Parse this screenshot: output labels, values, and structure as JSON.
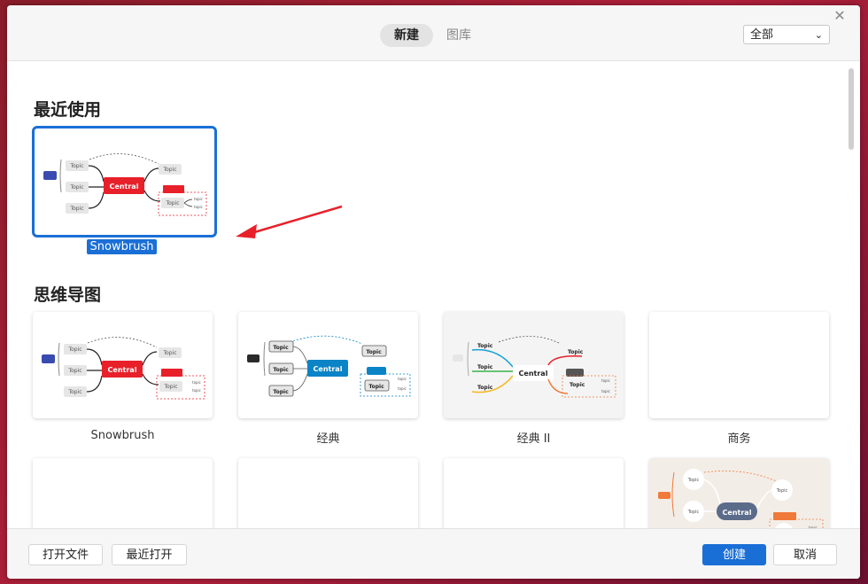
{
  "tabs": [
    {
      "label": "新建"
    },
    {
      "label": "图库"
    }
  ],
  "filter": {
    "selected": "全部"
  },
  "sections": {
    "recent_title": "最近使用",
    "mindmap_title": "思维导图"
  },
  "recent": [
    {
      "label": "Snowbrush"
    }
  ],
  "templates": [
    {
      "label": "Snowbrush"
    },
    {
      "label": "经典"
    },
    {
      "label": "经典 II"
    },
    {
      "label": "商务"
    },
    {
      "label": ""
    },
    {
      "label": ""
    },
    {
      "label": ""
    },
    {
      "label": ""
    }
  ],
  "diagram_text": {
    "central": "Central",
    "topic": "Topic",
    "small_topic": "topic"
  },
  "footer": {
    "open_file": "打开文件",
    "recent_open": "最近打开",
    "create": "创建",
    "cancel": "取消"
  },
  "colors": {
    "accent": "#1a6fd6",
    "snowbrush_red": "#e8202a",
    "classic_blue": "#0a84c6",
    "business_slate": "#5b6b8a",
    "business_orange": "#f07a3a"
  }
}
